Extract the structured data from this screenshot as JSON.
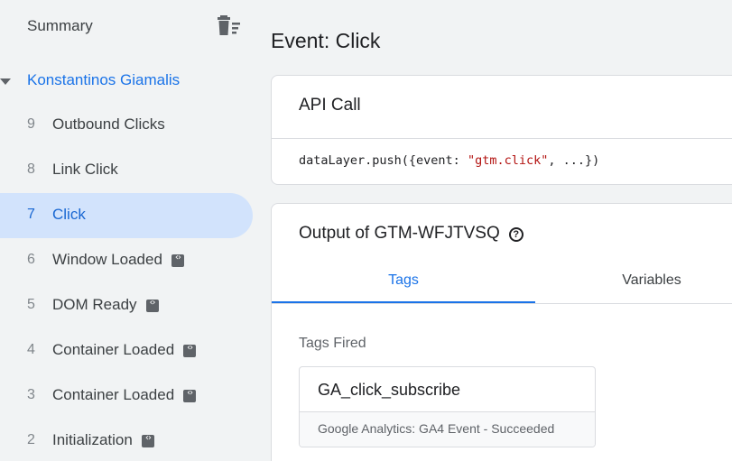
{
  "sidebar": {
    "summary_label": "Summary",
    "account_name": "Konstantinos Giamalis",
    "events": [
      {
        "num": "9",
        "label": "Outbound Clicks",
        "has_code_icon": false,
        "selected": false
      },
      {
        "num": "8",
        "label": "Link Click",
        "has_code_icon": false,
        "selected": false
      },
      {
        "num": "7",
        "label": "Click",
        "has_code_icon": false,
        "selected": true
      },
      {
        "num": "6",
        "label": "Window Loaded",
        "has_code_icon": true,
        "selected": false
      },
      {
        "num": "5",
        "label": "DOM Ready",
        "has_code_icon": true,
        "selected": false
      },
      {
        "num": "4",
        "label": "Container Loaded",
        "has_code_icon": true,
        "selected": false
      },
      {
        "num": "3",
        "label": "Container Loaded",
        "has_code_icon": true,
        "selected": false
      },
      {
        "num": "2",
        "label": "Initialization",
        "has_code_icon": true,
        "selected": false
      }
    ]
  },
  "main": {
    "title": "Event: Click",
    "api_card": {
      "title": "API Call",
      "code_prefix": "dataLayer.push({event: ",
      "code_string": "\"gtm.click\"",
      "code_suffix": ", ...})"
    },
    "output_card": {
      "title": "Output of GTM-WFJTVSQ",
      "help_glyph": "?",
      "tabs": [
        {
          "label": "Tags",
          "active": true
        },
        {
          "label": "Variables",
          "active": false
        }
      ],
      "section_label": "Tags Fired",
      "tag": {
        "name": "GA_click_subscribe",
        "status": "Google Analytics: GA4 Event - Succeeded"
      }
    }
  },
  "colors": {
    "accent": "#1a73e8",
    "selected_bg": "#d2e3fc",
    "code_string": "#b31412",
    "sidebar_bg": "#f1f3f4"
  },
  "icons": [
    "trash-sort-icon",
    "caret-down-icon",
    "code-icon",
    "help-icon"
  ]
}
